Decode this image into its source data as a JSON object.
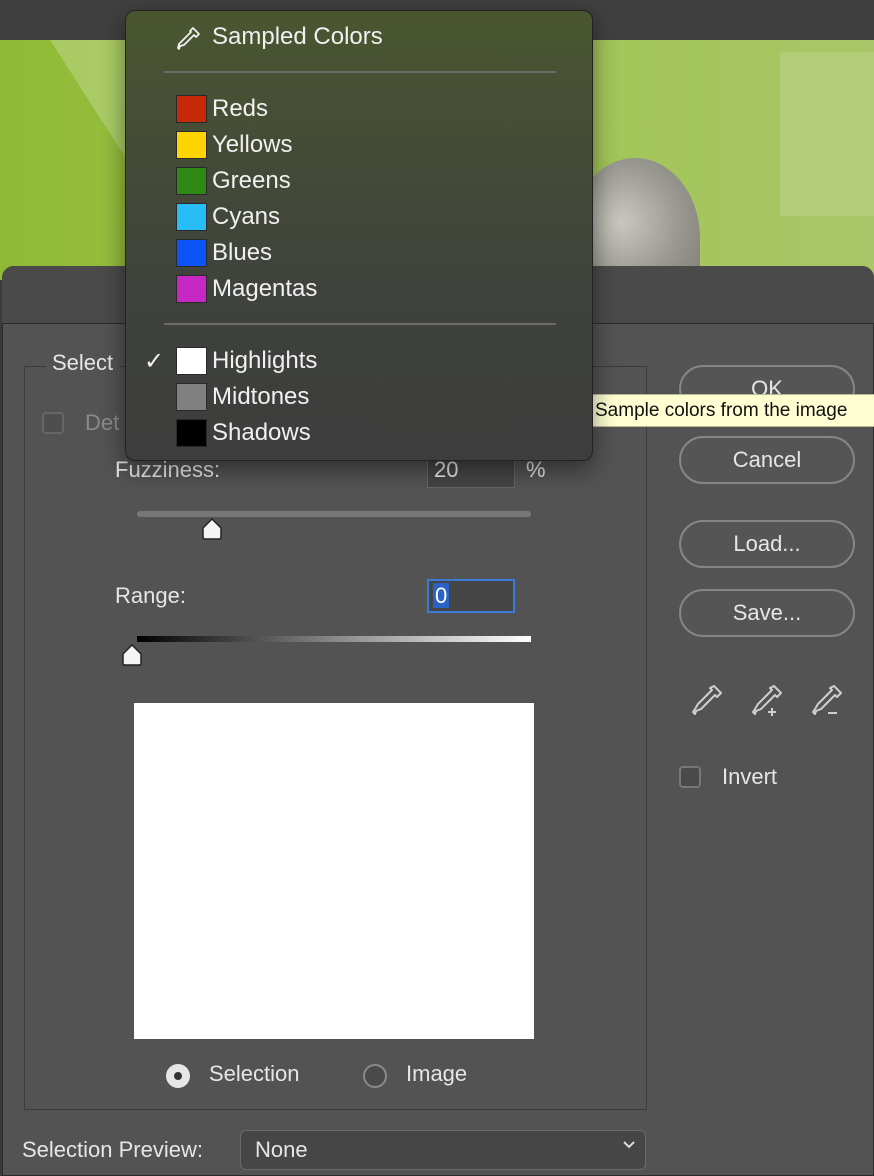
{
  "menu": {
    "header_label": "Sampled Colors",
    "items": [
      {
        "label": "Reds",
        "color": "#c62a08"
      },
      {
        "label": "Yellows",
        "color": "#ffd400"
      },
      {
        "label": "Greens",
        "color": "#2e8a14"
      },
      {
        "label": "Cyans",
        "color": "#28bdf5"
      },
      {
        "label": "Blues",
        "color": "#0c54f6"
      },
      {
        "label": "Magentas",
        "color": "#c728c5"
      }
    ],
    "tone_items": [
      {
        "label": "Highlights",
        "color": "#ffffff",
        "checked": true,
        "check_mark": "✓"
      },
      {
        "label": "Midtones",
        "color": "#808080",
        "checked": false
      },
      {
        "label": "Shadows",
        "color": "#000000",
        "checked": false
      }
    ]
  },
  "tooltip": "Sample colors from the image",
  "dialog": {
    "select_label": "Select",
    "detect_faces_label": "Det",
    "fuzziness": {
      "label": "Fuzziness:",
      "value": "20",
      "unit": "%",
      "level": 20
    },
    "range": {
      "label": "Range:",
      "value": "0",
      "level": 0
    },
    "radios": {
      "selection_label": "Selection",
      "image_label": "Image",
      "selected": "selection"
    },
    "selection_preview": {
      "label": "Selection Preview:",
      "value": "None"
    },
    "buttons": {
      "ok": "OK",
      "cancel": "Cancel",
      "load": "Load...",
      "save": "Save..."
    },
    "invert_label": "Invert",
    "accent_color": "#3b7bd8"
  }
}
